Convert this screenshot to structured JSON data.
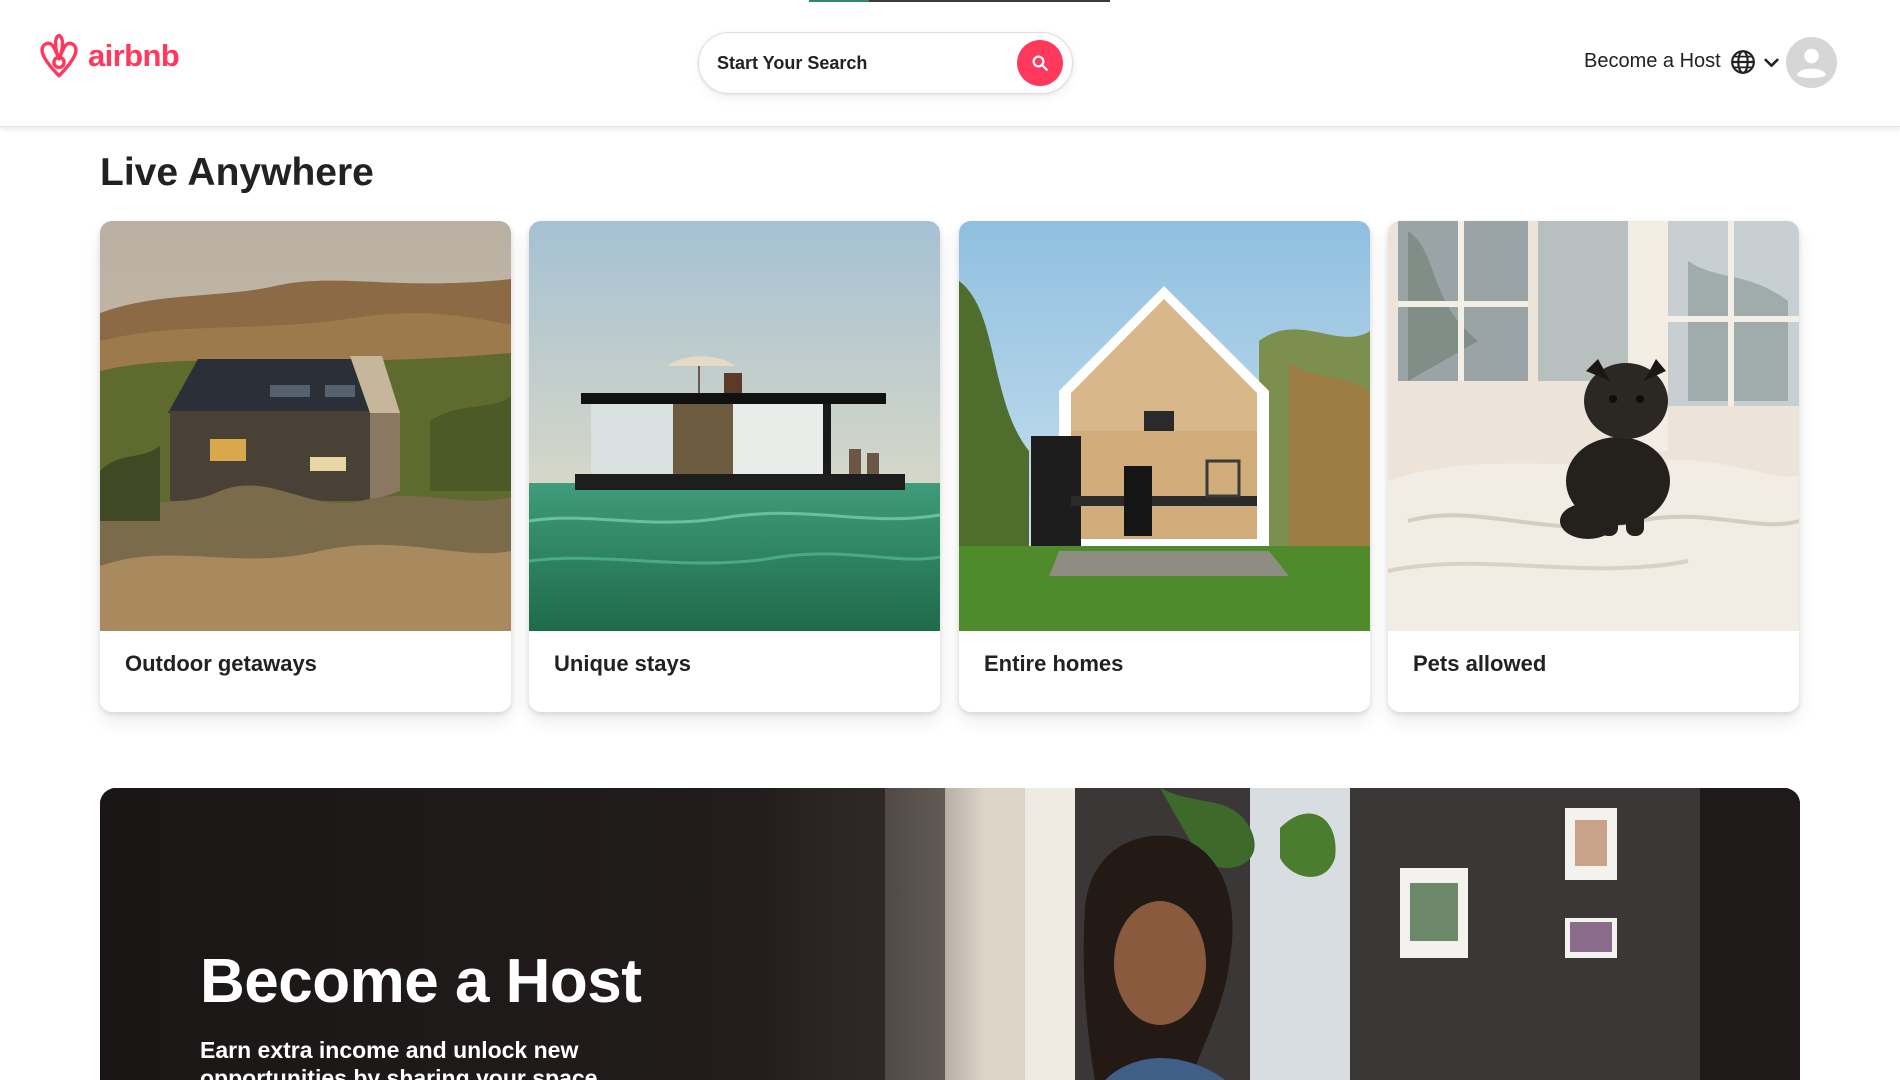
{
  "brand": {
    "name": "airbnb",
    "color": "#ff385c",
    "icon": "airbnb-belo-icon"
  },
  "header": {
    "progress": 0.2,
    "search": {
      "label": "Start Your Search",
      "icon": "search-icon"
    },
    "host_link": "Become a Host",
    "language_icon": "globe-icon",
    "menu_icon": "chevron-down-icon",
    "profile_icon": "user-avatar-icon"
  },
  "live_anywhere": {
    "title": "Live Anywhere",
    "cards": [
      {
        "label": "Outdoor getaways"
      },
      {
        "label": "Unique stays"
      },
      {
        "label": "Entire homes"
      },
      {
        "label": "Pets allowed"
      }
    ]
  },
  "host_banner": {
    "title": "Become a Host",
    "subtitle": "Earn extra income and unlock new opportunities by sharing your space."
  }
}
